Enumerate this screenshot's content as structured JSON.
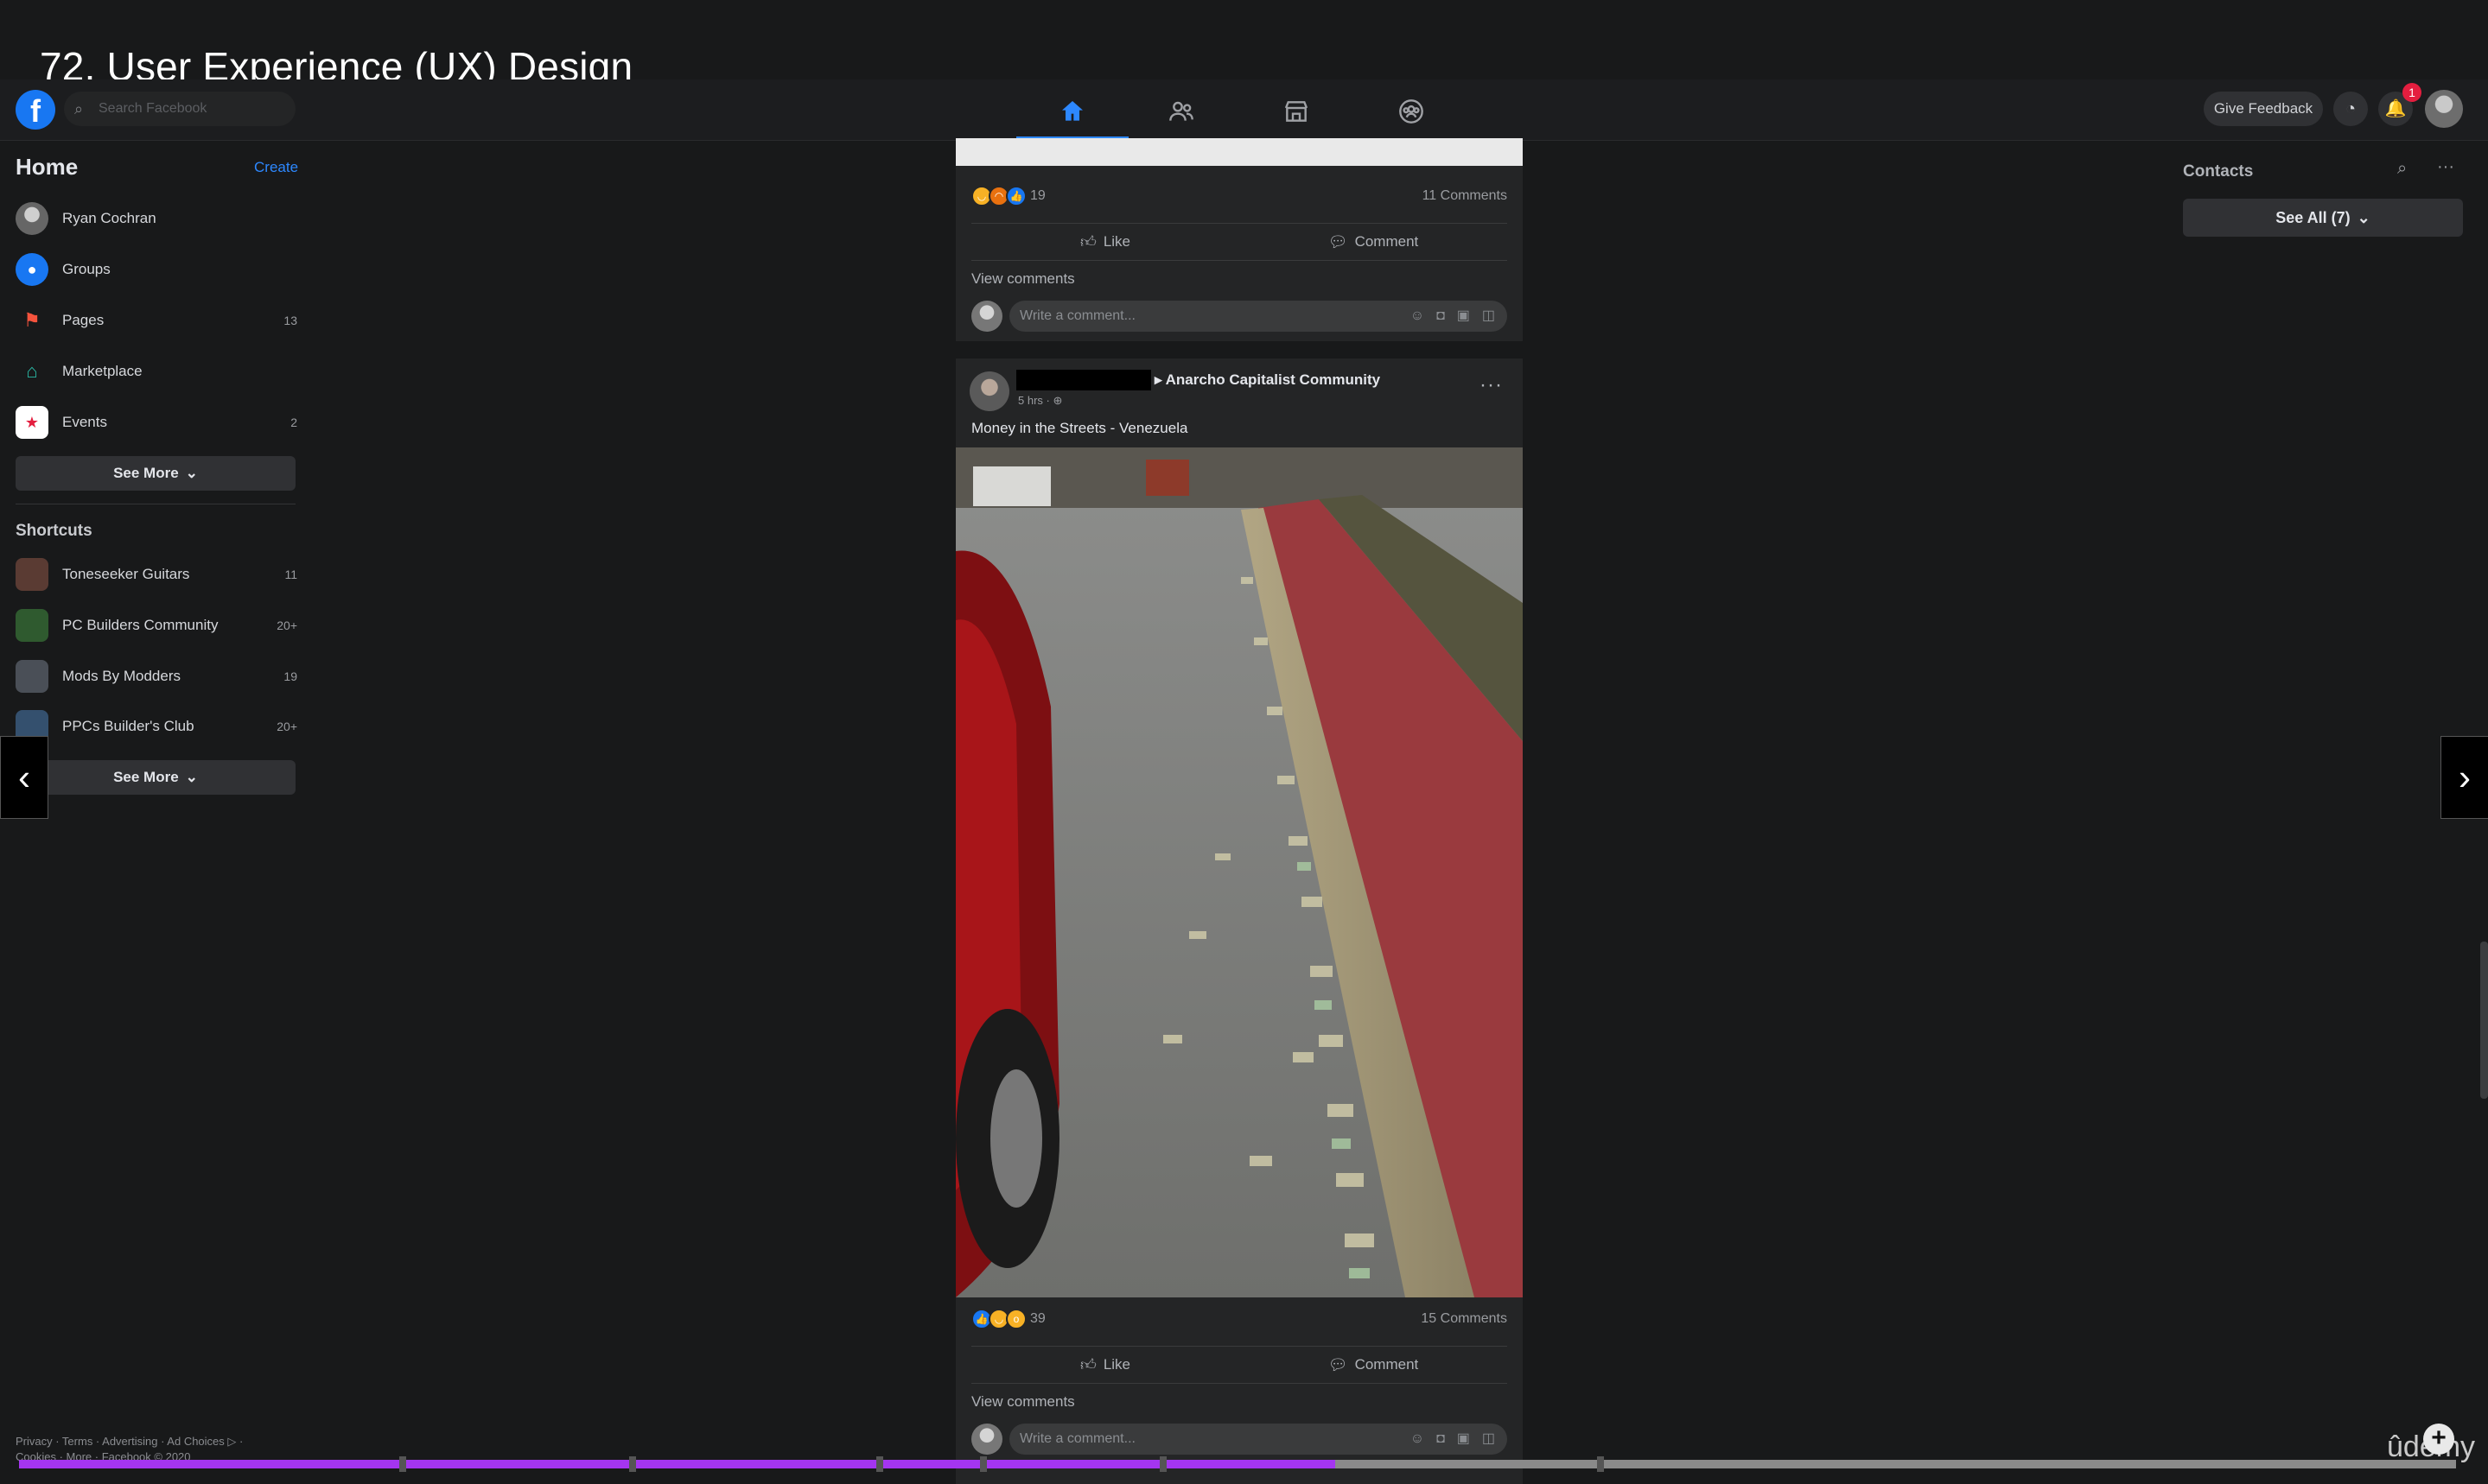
{
  "lecture": {
    "title": "72. User Experience (UX) Design"
  },
  "topnav": {
    "logo": "f",
    "search_placeholder": "Search Facebook",
    "tabs": [
      "home-icon",
      "friends-icon",
      "marketplace-icon",
      "groups-icon"
    ],
    "give_feedback": "Give Feedback",
    "notification_count": "1"
  },
  "sidebar": {
    "heading": "Home",
    "create_label": "Create",
    "items": [
      {
        "label": "Ryan Cochran",
        "count": ""
      },
      {
        "label": "Groups",
        "count": ""
      },
      {
        "label": "Pages",
        "count": "13"
      },
      {
        "label": "Marketplace",
        "count": ""
      },
      {
        "label": "Events",
        "count": "2"
      }
    ],
    "see_more": "See More",
    "shortcuts_heading": "Shortcuts",
    "shortcuts": [
      {
        "label": "Toneseeker Guitars",
        "count": "11"
      },
      {
        "label": "PC Builders Community",
        "count": "20+"
      },
      {
        "label": "Mods By Modders",
        "count": "19"
      },
      {
        "label": "PPCs Builder's Club",
        "count": "20+"
      }
    ],
    "see_more_2": "See More",
    "footer_line1": "Privacy · Terms · Advertising · Ad Choices ▷ ·",
    "footer_line2": "Cookies · More · Facebook © 2020"
  },
  "feed": {
    "post1": {
      "reactions": "19",
      "comments": "11 Comments",
      "like": "Like",
      "comment": "Comment",
      "view_comments": "View comments",
      "comment_placeholder": "Write a comment..."
    },
    "post2": {
      "group": "Anarcho Capitalist Community",
      "time": "5 hrs",
      "caption": "Money in the Streets - Venezuela",
      "reactions": "39",
      "comments": "15 Comments",
      "like": "Like",
      "comment": "Comment",
      "view_comments": "View comments",
      "comment_placeholder": "Write a comment..."
    }
  },
  "contacts": {
    "heading": "Contacts",
    "see_all": "See All (7)"
  },
  "player": {
    "progress": 0.54,
    "brand": "ûdemy"
  },
  "colors": {
    "accent": "#2d88ff",
    "progress": "#a435f0",
    "background": "#18191a"
  }
}
